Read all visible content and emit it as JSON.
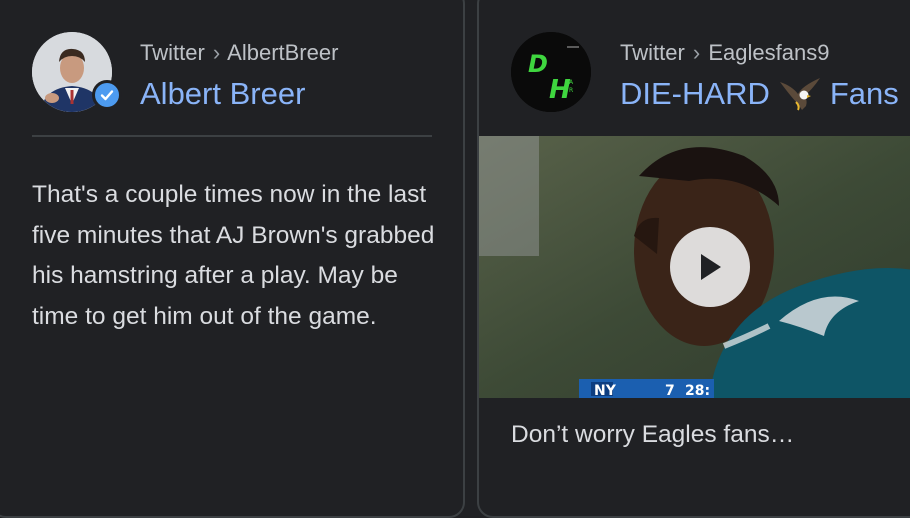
{
  "card1": {
    "source": "Twitter",
    "separator": "›",
    "handle": "AlbertBreer",
    "name": "Albert Breer",
    "text": "That's a couple times now in the last five minutes that AJ Brown's grabbed his hamstring after a play. May be time to get him out of the game."
  },
  "card2": {
    "source": "Twitter",
    "separator": "›",
    "handle": "Eaglesfans9",
    "name_part1": "DIE-HARD",
    "name_part2": "Fans",
    "caption": "Don’t worry Eagles fans…",
    "avatar_text": "DH",
    "scoreboard": {
      "team": "NY",
      "score": "7",
      "time": "28:"
    }
  },
  "colors": {
    "background": "#202124",
    "link": "#8ab4f8",
    "text": "#dadce0",
    "muted": "#bdc1c6",
    "verified": "#4d9bf0",
    "jersey": "#0e5566"
  },
  "icons": {
    "verified": "verified-badge-icon",
    "play": "play-icon",
    "eagle": "eagle-emoji-icon"
  }
}
